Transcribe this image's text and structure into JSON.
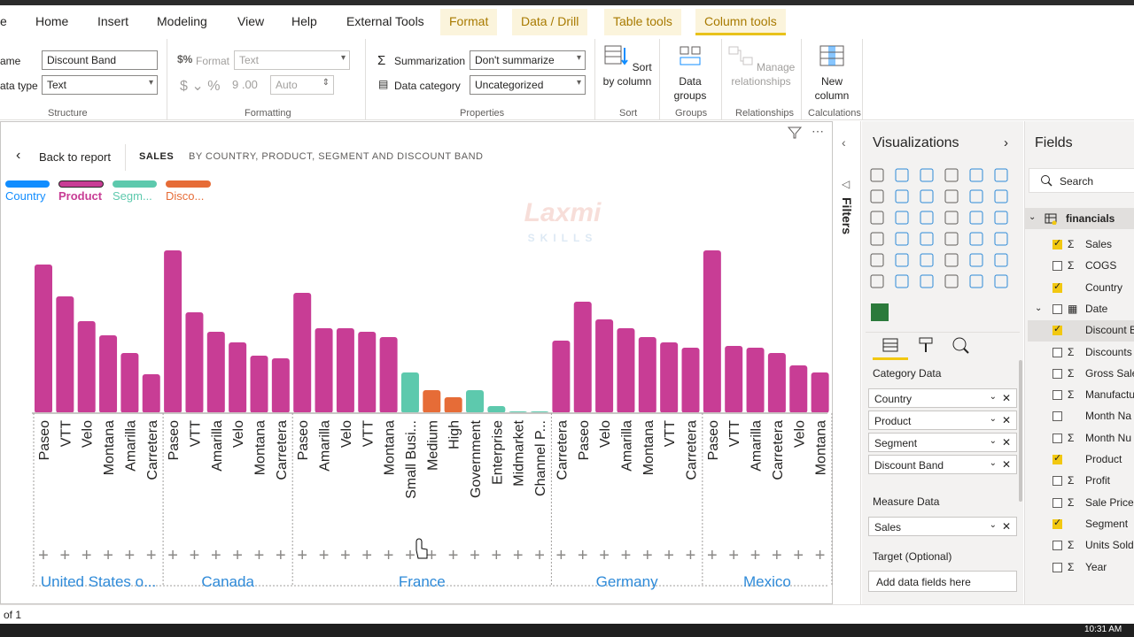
{
  "tabs": [
    "Home",
    "Insert",
    "Modeling",
    "View",
    "Help",
    "External Tools",
    "Format",
    "Data / Drill",
    "Table tools",
    "Column tools"
  ],
  "ribbon": {
    "name_label": "ame",
    "name_value": "Discount Band",
    "datatype_label": "ata type",
    "datatype_value": "Text",
    "structure_title": "Structure",
    "format_label": "Format",
    "format_value": "Text",
    "auto_value": "Auto",
    "formatting_title": "Formatting",
    "summarization_label": "Summarization",
    "summarization_value": "Don't summarize",
    "datacategory_label": "Data category",
    "datacategory_value": "Uncategorized",
    "properties_title": "Properties",
    "sort_btn": "Sort by column",
    "sort_title": "Sort",
    "groups_btn": "Data groups",
    "groups_title": "Groups",
    "relationships_btn": "Manage relationships",
    "relationships_title": "Relationships",
    "newcol_btn": "New column",
    "calc_title": "Calculations"
  },
  "report": {
    "back": "Back to report",
    "title": "SALES",
    "subtitle": "BY COUNTRY, PRODUCT, SEGMENT AND DISCOUNT BAND",
    "legend": [
      {
        "label": "Country",
        "color": "#118dff"
      },
      {
        "label": "Product",
        "color": "#c83d95"
      },
      {
        "label": "Segm...",
        "color": "#5dc9ad"
      },
      {
        "label": "Disco...",
        "color": "#e66c37"
      }
    ],
    "watermark_1": "Laxmi",
    "watermark_2": "SKILLS"
  },
  "chart_data": {
    "type": "bar",
    "categories": [
      "Paseo",
      "VTT",
      "Velo",
      "Montana",
      "Amarilla",
      "Carretera",
      "Paseo",
      "VTT",
      "Amarilla",
      "Velo",
      "Montana",
      "Carretera",
      "Paseo",
      "Amarilla",
      "Velo",
      "VTT",
      "Montana",
      "Small Busi...",
      "Medium",
      "High",
      "Government",
      "Enterprise",
      "Midmarket",
      "Channel P...",
      "Carretera",
      "Paseo",
      "Velo",
      "Amarilla",
      "Montana",
      "VTT",
      "Carretera",
      "Paseo",
      "VTT",
      "Amarilla",
      "Carretera",
      "Velo",
      "Montana"
    ],
    "groups": [
      "United States o...",
      "Canada",
      "France",
      "Germany",
      "Mexico"
    ],
    "values": [
      168,
      132,
      104,
      88,
      68,
      44,
      184,
      114,
      92,
      80,
      65,
      62,
      136,
      96,
      96,
      92,
      86,
      46,
      26,
      18,
      26,
      8,
      2,
      2,
      82,
      126,
      106,
      96,
      86,
      80,
      74,
      184,
      76,
      74,
      68,
      54,
      46
    ],
    "series_kind": [
      "product",
      "product",
      "product",
      "product",
      "product",
      "product",
      "product",
      "product",
      "product",
      "product",
      "product",
      "product",
      "product",
      "product",
      "product",
      "product",
      "product",
      "segment",
      "discount",
      "discount",
      "segment",
      "segment",
      "segment",
      "segment",
      "product",
      "product",
      "product",
      "product",
      "product",
      "product",
      "product",
      "product",
      "product",
      "product",
      "product",
      "product",
      "product"
    ],
    "grid": false
  },
  "filters_label": "Filters",
  "viz": {
    "title": "Visualizations",
    "category_data": "Category Data",
    "wells": [
      "Country",
      "Product",
      "Segment",
      "Discount Band"
    ],
    "measure_data": "Measure Data",
    "measure_well": "Sales",
    "target": "Target (Optional)",
    "add_fields": "Add data fields here"
  },
  "fields": {
    "title": "Fields",
    "search": "Search",
    "table": "financials",
    "items": [
      {
        "label": "Sales",
        "checked": true,
        "sigma": true
      },
      {
        "label": "COGS",
        "checked": false,
        "sigma": true
      },
      {
        "label": "Country",
        "checked": true,
        "sigma": false
      },
      {
        "label": "Date",
        "checked": false,
        "sigma": false
      },
      {
        "label": "Discount B",
        "checked": true,
        "sigma": false
      },
      {
        "label": "Discounts",
        "checked": false,
        "sigma": true
      },
      {
        "label": "Gross Sale",
        "checked": false,
        "sigma": true
      },
      {
        "label": "Manufactu",
        "checked": false,
        "sigma": true
      },
      {
        "label": "Month Na",
        "checked": false,
        "sigma": false
      },
      {
        "label": "Month Nu",
        "checked": false,
        "sigma": true
      },
      {
        "label": "Product",
        "checked": true,
        "sigma": false
      },
      {
        "label": "Profit",
        "checked": false,
        "sigma": true
      },
      {
        "label": "Sale Price",
        "checked": false,
        "sigma": true
      },
      {
        "label": "Segment",
        "checked": true,
        "sigma": false
      },
      {
        "label": "Units Sold",
        "checked": false,
        "sigma": true
      },
      {
        "label": "Year",
        "checked": false,
        "sigma": true
      }
    ]
  },
  "status": {
    "page": "of 1",
    "time": "10:31 AM"
  },
  "colors": {
    "product": "#c83d95",
    "segment": "#5dc9ad",
    "discount": "#e66c37",
    "country": "#118dff",
    "accent": "#f2c811"
  }
}
